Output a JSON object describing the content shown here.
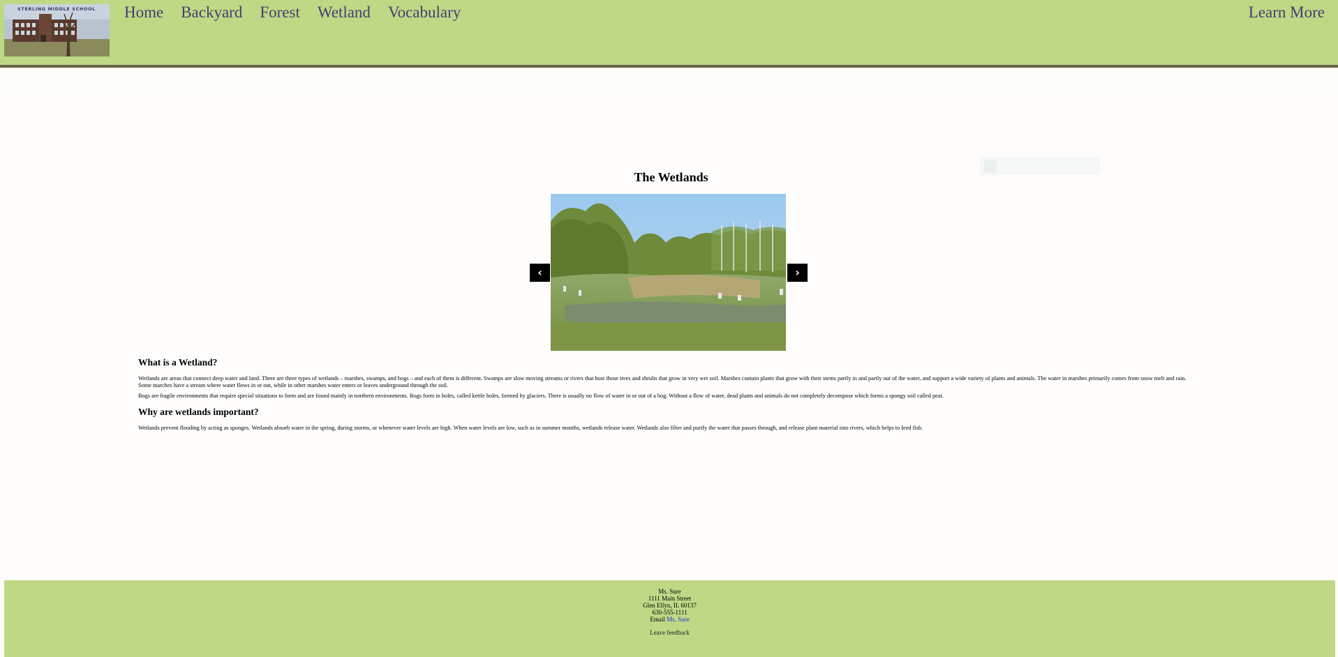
{
  "header": {
    "logo": {
      "text": "STERLING MIDDLE SCHOOL"
    },
    "nav": [
      {
        "label": "Home"
      },
      {
        "label": "Backyard"
      },
      {
        "label": "Forest"
      },
      {
        "label": "Wetland"
      },
      {
        "label": "Vocabulary"
      }
    ],
    "learn_more": "Learn More",
    "colors": {
      "band": "#bed886",
      "link": "#4a3d6e",
      "border": "#6b6449"
    }
  },
  "main": {
    "title": "The Wetlands",
    "carousel": {
      "prev_icon": "‹",
      "next_icon": "›"
    },
    "sections": [
      {
        "heading": "What is a Wetland?",
        "paragraphs": [
          "Wetlands are areas that connect deep water and land. There are three types of wetlands – marshes, swamps, and bogs – and each of them is different. Swamps are slow moving streams or rivers that host those trees and shrubs that grow in very wet soil. Marshes contain plants that grow with their stems partly in and partly out of the water, and support a wide variety of plants and animals. The water in marshes primarily comes from snow melt and rain. Some marches have a stream where water flows in or out, while in other marshes water enters or leaves underground through the soil.",
          "Bogs are fragile environments that require special situations to form and are found mainly in northern environments. Bogs form in holes, called kettle holes, formed by glaciers. There is usually no flow of water in or out of a bog. Without a flow of water, dead plants and animals do not completely decompose which forms a spongy soil called peat."
        ]
      },
      {
        "heading": "Why are wetlands important?",
        "paragraphs": [
          "Wetlands prevent flooding by acting as sponges. Wetlands absorb water in the spring, during storms, or whenever water levels are high. When water levels are low, such as in summer months, wetlands release water. Wetlands also filter and purify the water that passes through, and release plant material into rivers, which helps to feed fish."
        ]
      }
    ]
  },
  "footer": {
    "name": "Ms. Sure",
    "address1": "1111 Main Street",
    "address2": "Glen Ellyn, IL 60137",
    "phone": "630-555-1111",
    "email_prefix": "Email ",
    "email_link": "Ms. Sure",
    "feedback": "Leave feedback"
  }
}
